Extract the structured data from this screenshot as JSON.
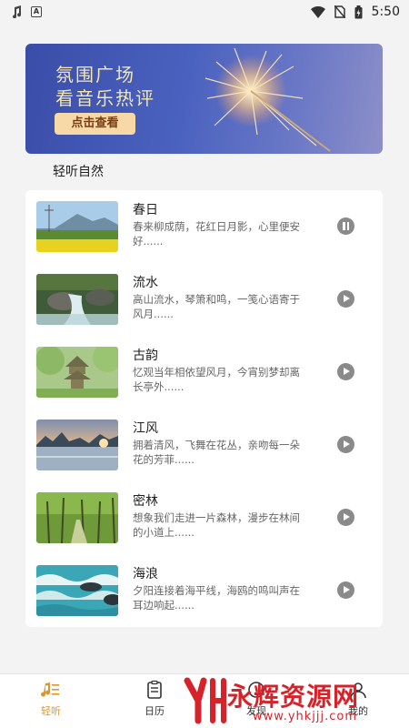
{
  "status_bar": {
    "time": "5:50",
    "left_icons": [
      "music-note-icon",
      "notification-a-icon"
    ],
    "right_icons": [
      "wifi-icon",
      "no-sim-icon",
      "battery-charging-icon"
    ]
  },
  "banner": {
    "line1": "氛围广场",
    "line2": "看音乐热评",
    "button_label": "点击查看"
  },
  "section_title": "轻听自然",
  "tracks": [
    {
      "title": "春日",
      "desc_line1": "春来柳成荫，花红日月影，心里便安",
      "desc_line2": "好......",
      "state": "playing"
    },
    {
      "title": "流水",
      "desc_line1": "高山流水，琴箫和鸣，一笺心语寄于",
      "desc_line2": "风月......",
      "state": "paused"
    },
    {
      "title": "古韵",
      "desc_line1": "忆观当年相依望风月，今宵别梦却离",
      "desc_line2": "长亭外......",
      "state": "paused"
    },
    {
      "title": "江风",
      "desc_line1": "拥着清风，飞舞在花丛，亲吻每一朵",
      "desc_line2": "花的芳菲......",
      "state": "paused"
    },
    {
      "title": "密林",
      "desc_line1": "想象我们走进一片森林，漫步在林间",
      "desc_line2": "的小道上......",
      "state": "paused"
    },
    {
      "title": "海浪",
      "desc_line1": "夕阳连接着海平线，海鸥的鸣叫声在",
      "desc_line2": "耳边响起......",
      "state": "paused"
    }
  ],
  "tabs": [
    {
      "label": "轻听",
      "icon": "music-list-icon",
      "active": true
    },
    {
      "label": "日历",
      "icon": "calendar-icon",
      "active": false
    },
    {
      "label": "发现",
      "icon": "discover-icon",
      "active": false
    },
    {
      "label": "我的",
      "icon": "profile-icon",
      "active": false
    }
  ],
  "watermark": {
    "text": "永辉资源网",
    "url": "www.yhkjjj.com"
  },
  "colors": {
    "accent": "#e0952b",
    "banner_blue": "#4a62bf",
    "watermark_red": "#d8222a"
  }
}
